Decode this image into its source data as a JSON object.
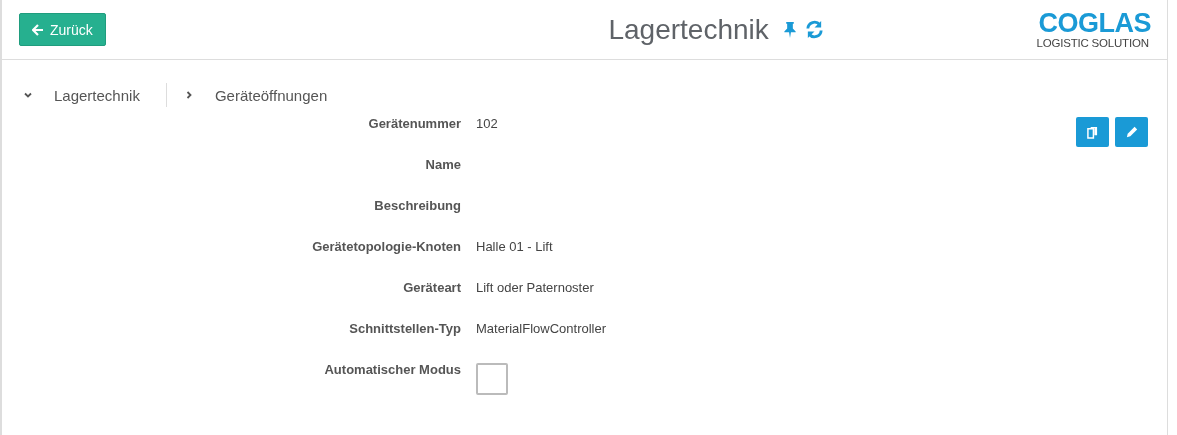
{
  "back_button": {
    "label": "Zurück"
  },
  "title": "Lagertechnik",
  "logo": {
    "name": "COGLAS",
    "tagline": "LOGISTIC SOLUTION"
  },
  "breadcrumb": [
    {
      "label": "Lagertechnik",
      "expanded": true
    },
    {
      "label": "Geräteöffnungen",
      "expanded": false
    }
  ],
  "fields": [
    {
      "kind": "text",
      "label": "Gerätenummer",
      "value": "102"
    },
    {
      "kind": "text",
      "label": "Name"
    },
    {
      "kind": "text",
      "label": "Beschreibung"
    },
    {
      "kind": "text",
      "label": "Gerätetopologie-Knoten",
      "value": "Halle 01 - Lift"
    },
    {
      "kind": "text",
      "label": "Geräteart",
      "value": "Lift oder Paternoster"
    },
    {
      "kind": "text",
      "label": "Schnittstellen-Typ",
      "value": "MaterialFlowController"
    },
    {
      "kind": "checkbox",
      "label": "Automatischer Modus",
      "checked": false
    }
  ]
}
